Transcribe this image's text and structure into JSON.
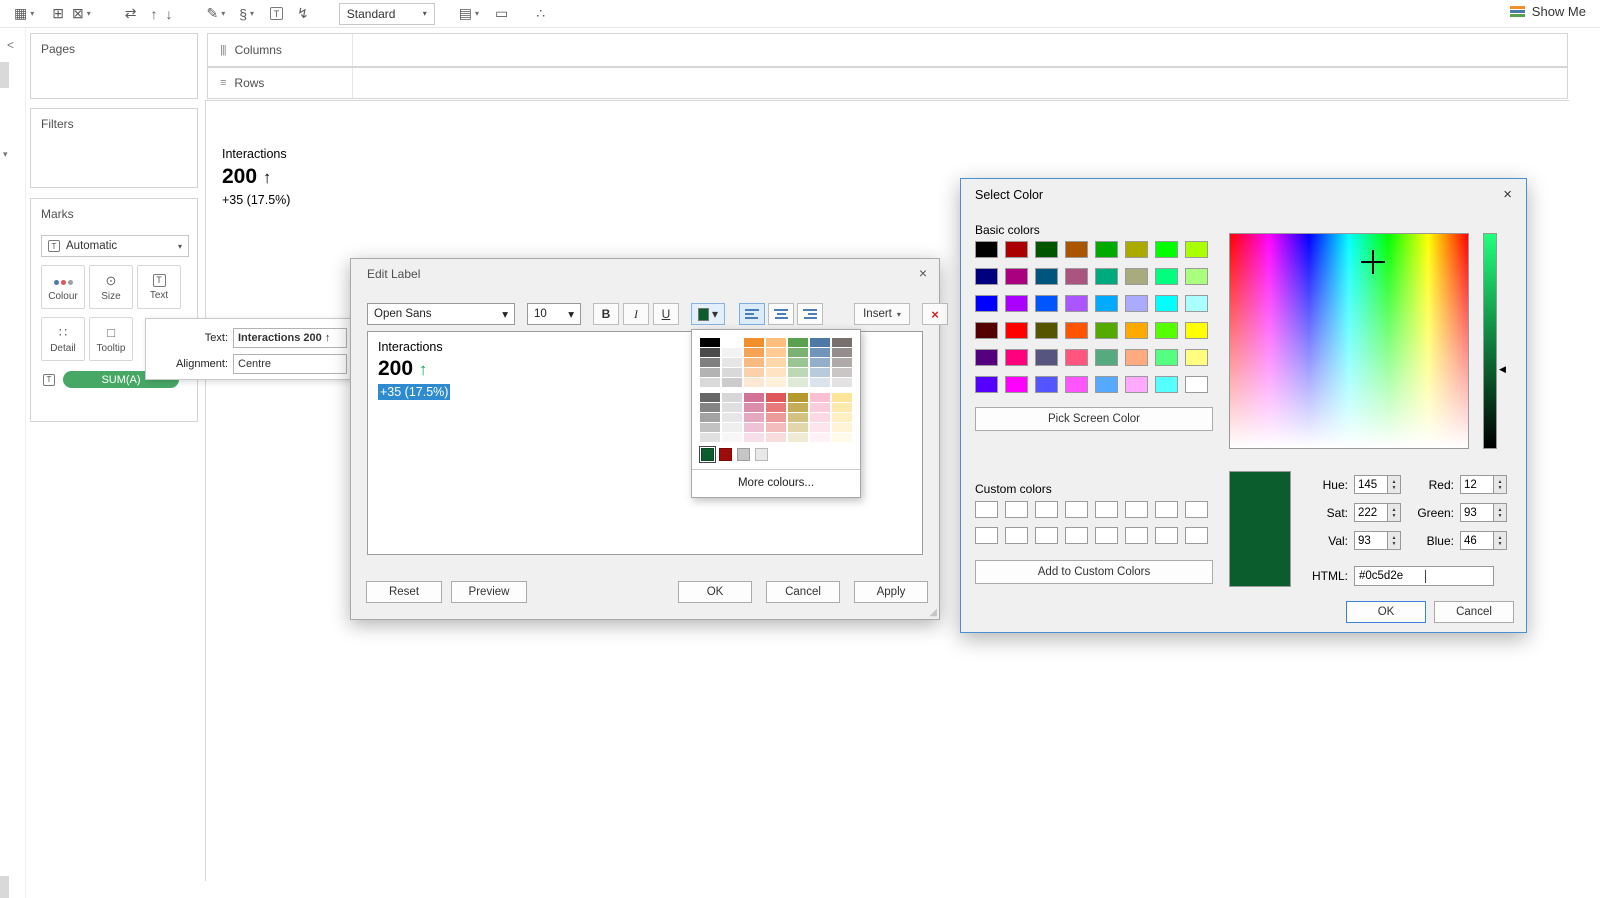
{
  "ui": {
    "caret": "▾",
    "close": "×",
    "spin_up": "▲",
    "spin_down": "▼",
    "slider_arrow": "◀",
    "resize_grip": "◢",
    "collapse_chevron": "<",
    "side_caret": "▾",
    "text_mark_glyph": "T"
  },
  "toolbar": {
    "items": [
      {
        "id": "new-data-source",
        "glyph": "▦",
        "caret": true
      },
      {
        "id": "new-worksheet",
        "glyph": "⊞",
        "caret": false
      },
      {
        "id": "clear-sheet",
        "glyph": "⊠",
        "caret": true
      },
      {
        "id": "swap-rows-columns",
        "glyph": "⇄",
        "caret": false
      },
      {
        "id": "sort-ascending",
        "glyph": "↑",
        "caret": false
      },
      {
        "id": "sort-descending",
        "glyph": "↓",
        "caret": false
      },
      {
        "id": "highlight",
        "glyph": "✎",
        "caret": true
      },
      {
        "id": "group-members",
        "glyph": "§",
        "caret": true
      },
      {
        "id": "show-mark-labels",
        "glyph": "T",
        "caret": false
      },
      {
        "id": "fix-axes",
        "glyph": "↯",
        "caret": false
      },
      {
        "id": "show-hide-cards",
        "glyph": "▤",
        "caret": true
      },
      {
        "id": "presentation-mode",
        "glyph": "▭",
        "caret": false
      },
      {
        "id": "share",
        "glyph": "∴",
        "caret": false
      }
    ],
    "view_select": "Standard",
    "show_me": "Show Me",
    "show_me_colors": [
      "#f28e2b",
      "#4e79a7",
      "#59a14f"
    ]
  },
  "cards": {
    "pages": "Pages",
    "filters": "Filters"
  },
  "marks": {
    "title": "Marks",
    "mark_type": "Automatic",
    "buttons": [
      {
        "id": "colour",
        "label": "Colour",
        "glyph": ""
      },
      {
        "id": "size",
        "label": "Size",
        "glyph": "⊙"
      },
      {
        "id": "text",
        "label": "Text",
        "glyph": "T"
      },
      {
        "id": "detail",
        "label": "Detail",
        "glyph": "∷"
      },
      {
        "id": "tooltip",
        "label": "Tooltip",
        "glyph": "□"
      }
    ],
    "colour_dots": [
      "#4e79a7",
      "#e15759",
      "#9aa0a6"
    ],
    "pill": {
      "label": "SUM(A)",
      "color": "#47a865"
    }
  },
  "shelves": {
    "columns": {
      "icon": "|||",
      "label": "Columns"
    },
    "rows": {
      "icon": "≡",
      "label": "Rows"
    }
  },
  "viz": {
    "title": "Interactions",
    "value": "200",
    "arrow": "↑",
    "delta": "+35 (17.5%)"
  },
  "label_flyout": {
    "text_label": "Text:",
    "text_value": "Interactions 200 ↑",
    "alignment_label": "Alignment:",
    "alignment_value": "Centre"
  },
  "edit_label": {
    "title": "Edit Label",
    "font": "Open Sans",
    "size": "10",
    "bold": "B",
    "italic": "I",
    "underline": "U",
    "insert": "Insert",
    "clear": "×",
    "color_swatch": "#0c5d2e",
    "preview": {
      "line1": "Interactions",
      "value": "200",
      "arrow": "↑",
      "arrow_color": "#18a05a",
      "selected_text": "+35 (17.5%)",
      "selection_color": "#2e8bd0"
    },
    "palette": {
      "block1": [
        [
          "#000000",
          "#4a4a4a",
          "#808080",
          "#b3b3b3",
          "#d9d9d9"
        ],
        [
          "#ffffff",
          "#f2f2f2",
          "#e6e6e6",
          "#d9d9d9",
          "#cccccc"
        ],
        [
          "#f28e2b",
          "#f5a455",
          "#f8ba80",
          "#fbd1aa",
          "#fde8d5"
        ],
        [
          "#ffbe7d",
          "#ffca94",
          "#ffd7ab",
          "#ffe3c3",
          "#fff0da"
        ],
        [
          "#59a14f",
          "#7ab371",
          "#9bc593",
          "#bcd8b5",
          "#deead7"
        ],
        [
          "#4e79a7",
          "#7194b9",
          "#94afca",
          "#b8cadc",
          "#dbe4ed"
        ],
        [
          "#79706e",
          "#948d8b",
          "#afaaa8",
          "#c9c6c5",
          "#e4e2e2"
        ]
      ],
      "block2": [
        [
          "#666666",
          "#858585",
          "#a3a3a3",
          "#c2c2c2",
          "#e0e0e0"
        ],
        [
          "#d7d7d7",
          "#dfdfdf",
          "#e7e7e7",
          "#efefef",
          "#f7f7f7"
        ],
        [
          "#d37295",
          "#dc8daa",
          "#e5a8bf",
          "#eec3d5",
          "#f6deea"
        ],
        [
          "#e15759",
          "#e7797a",
          "#ed9a9b",
          "#f3bcbd",
          "#f9ddde"
        ],
        [
          "#b6992d",
          "#c5ad57",
          "#d3c281",
          "#e2d6ab",
          "#f0ebd5"
        ],
        [
          "#fabfd2",
          "#fbccdb",
          "#fcd9e4",
          "#fde5ed",
          "#fef2f6"
        ],
        [
          "#ffe599",
          "#ffeaad",
          "#ffefc2",
          "#fff5d6",
          "#fffaea"
        ]
      ],
      "recent": [
        "#0c5d2e",
        "#9d0b0b",
        "#c6c6c6",
        "#e8e8e8"
      ],
      "selected_index": 0,
      "more": "More colours..."
    },
    "buttons": {
      "reset": "Reset",
      "preview": "Preview",
      "ok": "OK",
      "cancel": "Cancel",
      "apply": "Apply"
    }
  },
  "select_color": {
    "title": "Select Color",
    "basic_label": "Basic colors",
    "basic_colors": [
      "#000000",
      "#aa0000",
      "#005500",
      "#aa5500",
      "#00aa00",
      "#aaaa00",
      "#00ff00",
      "#aaff00",
      "#00007f",
      "#aa007f",
      "#00557f",
      "#aa557f",
      "#00aa7f",
      "#aaaa7f",
      "#00ff7f",
      "#aaff7f",
      "#0000ff",
      "#aa00ff",
      "#0055ff",
      "#aa55ff",
      "#00aaff",
      "#aaaaff",
      "#00ffff",
      "#aaffff",
      "#550000",
      "#ff0000",
      "#555500",
      "#ff5500",
      "#55aa00",
      "#ffaa00",
      "#55ff00",
      "#ffff00",
      "#55007f",
      "#ff007f",
      "#55557f",
      "#ff557f",
      "#55aa7f",
      "#ffaa7f",
      "#55ff7f",
      "#ffff7f",
      "#5500ff",
      "#ff00ff",
      "#5555ff",
      "#ff55ff",
      "#55aaff",
      "#ffaaff",
      "#55ffff",
      "#ffffff"
    ],
    "pick_screen": "Pick Screen Color",
    "custom_label": "Custom colors",
    "custom_count": 16,
    "add_custom": "Add to Custom Colors",
    "current": "#0c5d2e",
    "slider_top_color": "#21ff7d",
    "hsv": [
      {
        "label": "Hue:",
        "value": "145"
      },
      {
        "label": "Sat:",
        "value": "222"
      },
      {
        "label": "Val:",
        "value": "93"
      }
    ],
    "rgb": [
      {
        "label": "Red:",
        "value": "12"
      },
      {
        "label": "Green:",
        "value": "93"
      },
      {
        "label": "Blue:",
        "value": "46"
      }
    ],
    "html_label": "HTML:",
    "html_value": "#0c5d2e",
    "ok": "OK",
    "cancel": "Cancel"
  }
}
